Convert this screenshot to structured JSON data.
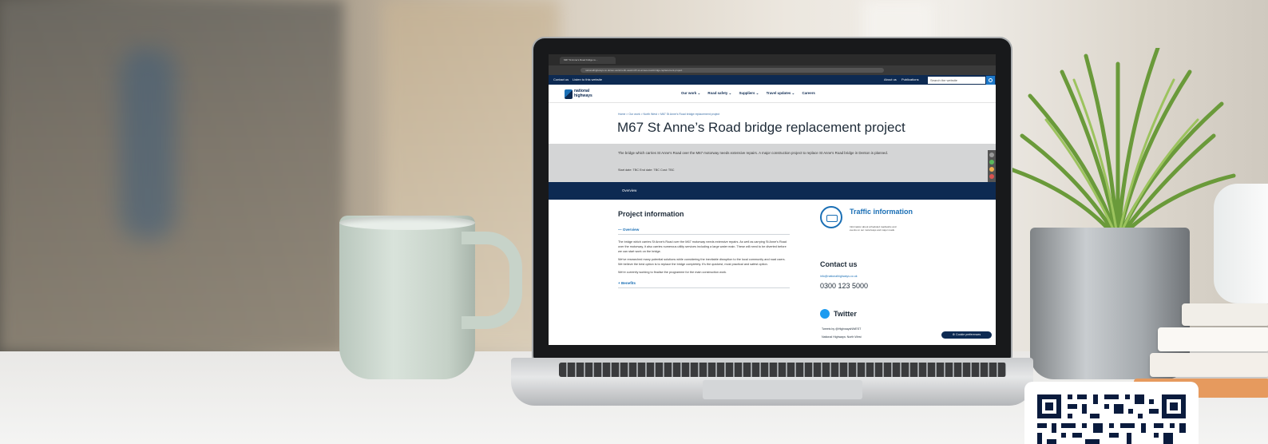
{
  "browser": {
    "tab_title": "M67 St Anne's Road bridge re...",
    "address": "nationalhighways.co.uk/our-work/north-west/m67-st-annes-road-bridge-replacement-project"
  },
  "utility_bar": {
    "contact": "Contact us",
    "listen": "Listen to this website",
    "about": "About us",
    "publications": "Publications",
    "search_placeholder": "Search the website"
  },
  "logo": {
    "line1": "national",
    "line2": "highways"
  },
  "nav": {
    "items": [
      "Our work ⌄",
      "Road safety ⌄",
      "Suppliers ⌄",
      "Travel updates ⌄",
      "Careers"
    ]
  },
  "breadcrumb": "Home  >  Our work  >  North West  >  M67 St Anne's Road bridge replacement project",
  "page": {
    "title": "M67 St Anne’s Road bridge replacement project",
    "summary": "The bridge which carries St Anne's Road over the M67 motorway needs extensive repairs. A major construction project to replace St Anne's Road bridge in Denton is planned.",
    "meta": "Start date: TBC    End date: TBC    Cost: TBC",
    "tab": "Overview"
  },
  "content": {
    "heading": "Project information",
    "accordion_open": "—   Overview",
    "para1": "The bridge which carries St Anne's Road over the M67 motorway needs extensive repairs. As well as carrying St Anne's Road over the motorway, it also carries numerous utility services including a large water main. These will need to be diverted before we can start work on the bridge.",
    "para2": "We've researched many potential solutions while considering the inevitable disruption to the local community and road users. We believe the best option is to replace the bridge completely. It's the quickest, most practical and safest option.",
    "para3": "We're currently working to finalise the programme for the main construction work.",
    "accordion_closed": "+   Benefits"
  },
  "aside": {
    "traffic_title": "Traffic information",
    "traffic_desc": "Information about scheduled roadworks and events on our motorways and major roads",
    "contact_heading": "Contact us",
    "email": "info@nationalhighways.co.uk",
    "phone": "0300 123 5000",
    "twitter_heading": "Twitter",
    "tweets_label": "Tweets  by @HighwaysNWEST",
    "tweet_author": "National Highways: North West"
  },
  "cookie_button": "⚙  Cookie preferences",
  "colors": {
    "navy": "#0d2a52",
    "link_blue": "#1a6fb5",
    "twitter_blue": "#1d9bf0",
    "summary_grey": "#d4d5d6"
  }
}
